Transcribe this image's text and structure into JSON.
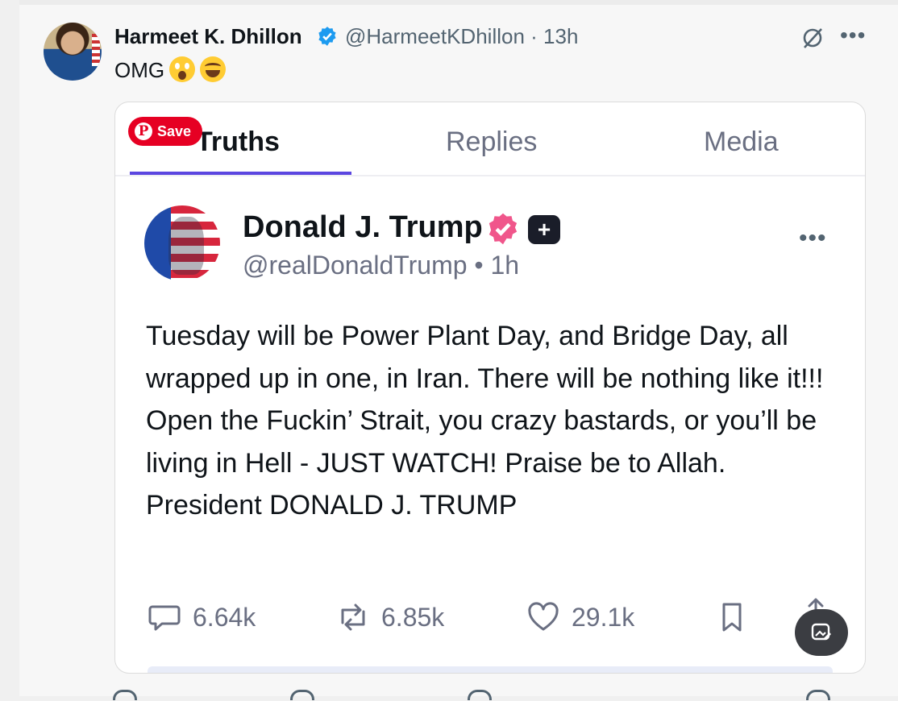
{
  "tweet": {
    "author_name": "Harmeet K. Dhillon",
    "author_handle": "@HarmeetKDhillon · 13h",
    "text": "OMG",
    "emojis": [
      "face-screaming-in-fear",
      "grinning-squinting-face"
    ],
    "verified_color": "#1d9bf0"
  },
  "embed": {
    "tabs": [
      {
        "label": "Truths",
        "active": true
      },
      {
        "label": "Replies",
        "active": false
      },
      {
        "label": "Media",
        "active": false
      }
    ],
    "pinterest_save_label": "Save",
    "pinterest_logo": "P",
    "accent_color": "#5b46e0",
    "post": {
      "author_name": "Donald J. Trump",
      "author_handle": "@realDonaldTrump • 1h",
      "plus_badge": "+",
      "badge_color": "#f0568b",
      "body": "Tuesday will be Power Plant Day, and Bridge Day, all wrapped up in one, in Iran. There will be nothing like it!!! Open the Fuckin’ Strait, you crazy bastards, or you’ll be living in Hell - JUST WATCH! Praise be to Allah. President DONALD J. TRUMP",
      "stats": {
        "replies": "6.64k",
        "retruths": "6.85k",
        "likes": "29.1k"
      }
    }
  },
  "more_label": "•••"
}
